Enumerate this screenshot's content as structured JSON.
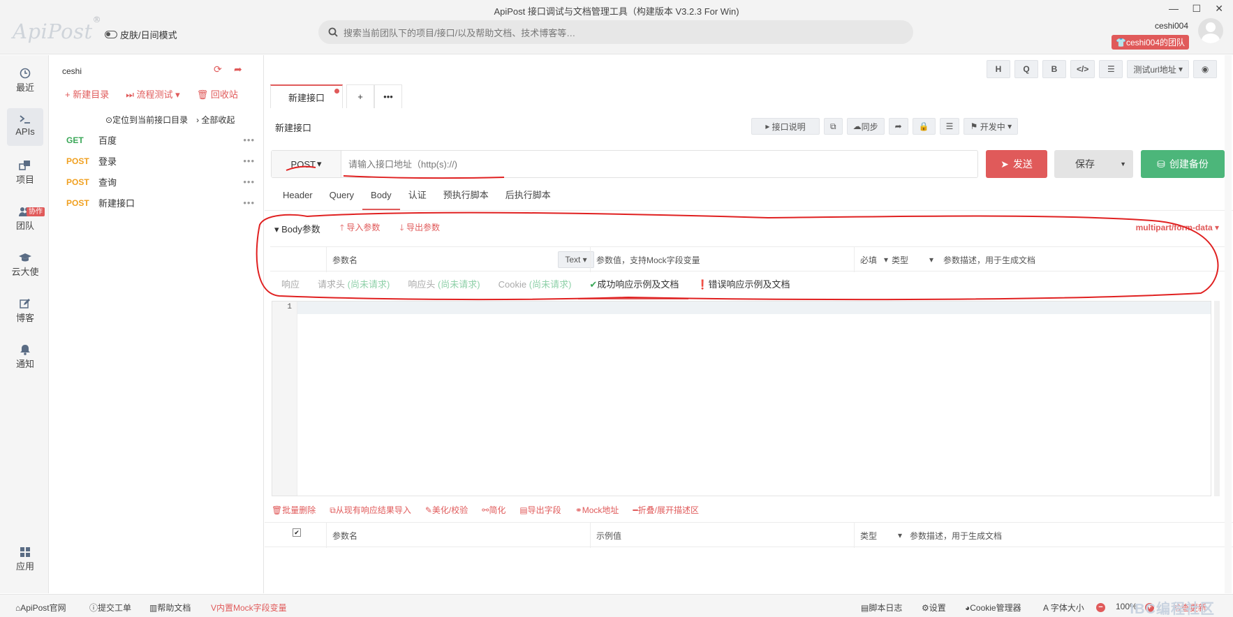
{
  "window": {
    "title": "ApiPost 接口调试与文档管理工具（构建版本 V3.2.3 For Win)",
    "minimize": "—",
    "maximize": "☐",
    "close": "✕"
  },
  "header": {
    "logo": "ApiPost",
    "logo_mark": "®",
    "skin_mode": "皮肤/日间模式",
    "search_placeholder": "搜索当前团队下的项目/接口/以及帮助文档、技术博客等…",
    "username": "ceshi004",
    "team_badge": "ceshi004的团队"
  },
  "leftnav": {
    "items": [
      {
        "label": "最近",
        "icon": "clock-icon"
      },
      {
        "label": "APIs",
        "icon": "terminal-icon"
      },
      {
        "label": "项目",
        "icon": "project-icon"
      },
      {
        "label": "团队",
        "icon": "team-icon",
        "badge": "协作"
      },
      {
        "label": "云大使",
        "icon": "graduation-cap-icon"
      },
      {
        "label": "博客",
        "icon": "edit-icon"
      },
      {
        "label": "通知",
        "icon": "bell-icon"
      },
      {
        "label": "应用",
        "icon": "grid-icon"
      }
    ]
  },
  "tree": {
    "project": "ceshi",
    "new_folder": "新建目录",
    "flow_test": "流程测试",
    "recycle": "回收站",
    "locate": "定位到当前接口目录",
    "collapse": "全部收起",
    "apis": [
      {
        "method": "GET",
        "name": "百度"
      },
      {
        "method": "POST",
        "name": "登录"
      },
      {
        "method": "POST",
        "name": "查询"
      },
      {
        "method": "POST",
        "name": "新建接口"
      }
    ]
  },
  "toolbar": {
    "h": "H",
    "q": "Q",
    "b": "B",
    "code": "</>",
    "sliders": "☰",
    "env": "测试url地址",
    "eye": "◉"
  },
  "tabs": {
    "active": "新建接口",
    "add": "+",
    "more": "•••"
  },
  "api": {
    "title": "新建接口",
    "doc_btn": "接口说明",
    "sync": "同步",
    "status": "开发中",
    "method": "POST",
    "url_placeholder": "请输入接口地址（http(s)://)",
    "send": "发送",
    "save": "保存",
    "backup": "创建备份"
  },
  "request_tabs": [
    "Header",
    "Query",
    "Body",
    "认证",
    "预执行脚本",
    "后执行脚本"
  ],
  "body": {
    "label": "Body参数",
    "import": "导入参数",
    "export": "导出参数",
    "content_type": "multipart/form-data",
    "col_name": "参数名",
    "col_type_sel": "Text",
    "col_value": "参数值，支持Mock字段变量",
    "col_required": "必填",
    "col_type": "类型",
    "col_desc": "参数描述，用于生成文档"
  },
  "response_tabs": {
    "response": "响应",
    "req_headers": "请求头",
    "resp_headers": "响应头",
    "cookie": "Cookie",
    "not_requested": "(尚未请求)",
    "success_doc": "成功响应示例及文档",
    "error_doc": "错误响应示例及文档"
  },
  "editor": {
    "line": "1"
  },
  "actions": {
    "batch_delete": "批量删除",
    "import_resp": "从现有响应结果导入",
    "beautify": "美化/校验",
    "simplify": "简化",
    "export_fields": "导出字段",
    "mock_url": "Mock地址",
    "fold": "折叠/展开描述区"
  },
  "resp_table": {
    "check": "✔",
    "col_name": "参数名",
    "col_example": "示例值",
    "col_type": "类型",
    "col_desc": "参数描述，用于生成文档"
  },
  "footer": {
    "site": "ApiPost官网",
    "ticket": "提交工单",
    "help": "帮助文档",
    "mock": "内置Mock字段变量",
    "script_log": "脚本日志",
    "settings": "设置",
    "cookie_mgr": "Cookie管理器",
    "font_size": "字体大小",
    "zoom": "100%",
    "update": "检查更新",
    "watermark": "IBC编程社区"
  },
  "colors": {
    "accent": "#e05a5a",
    "green": "#4cb67a",
    "get": "#3aa757",
    "post": "#f0a020"
  }
}
